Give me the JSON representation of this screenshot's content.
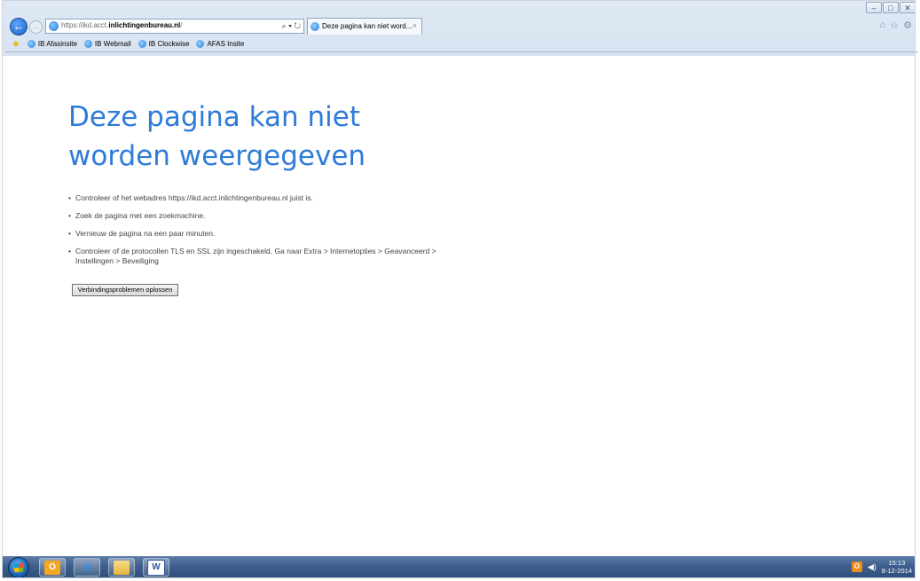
{
  "browser": {
    "address": {
      "prefix": "https://ikd.acct.",
      "domain": "inlichtingenbureau.nl",
      "suffix": "/",
      "tools": "⌕ ▾ ↻"
    },
    "tab": {
      "title": "Deze pagina kan niet word...",
      "close": "×"
    },
    "window_controls": {
      "minimize": "–",
      "maximize": "□",
      "close": "✕"
    },
    "favorites": [
      {
        "label": "IB Afasinsite"
      },
      {
        "label": "IB Webmail"
      },
      {
        "label": "IB Clockwise"
      },
      {
        "label": "AFAS Insite"
      }
    ],
    "right_icons": {
      "home": "⌂",
      "favorites": "☆",
      "settings": "⚙"
    }
  },
  "page": {
    "title": "Deze pagina kan niet worden weergegeven",
    "bullet": "•",
    "tips": [
      "Controleer of het webadres https://ikd.acct.inlichtingenbureau.nl juist is.",
      "Zoek de pagina met een zoekmachine.",
      "Vernieuw de pagina na een paar minuten.",
      "Controleer of de protocollen TLS en SSL zijn ingeschakeld. Ga naar Extra > Internetopties > Geavanceerd > Instellingen > Beveiliging"
    ],
    "button_label": "Verbindingsproblemen oplossen"
  },
  "taskbar": {
    "apps": [
      {
        "name": "outlook",
        "glyph": "O"
      },
      {
        "name": "internet-explorer",
        "glyph": "e"
      },
      {
        "name": "file-explorer",
        "glyph": ""
      },
      {
        "name": "word",
        "glyph": "W"
      }
    ],
    "tray_icon_glyph": "O",
    "speaker_glyph": "◀)",
    "clock": {
      "time": "15:13",
      "date": "8-12-2014"
    }
  },
  "colors": {
    "title_blue": "#2e7bd8",
    "taskbar": "#3e5f8c"
  }
}
